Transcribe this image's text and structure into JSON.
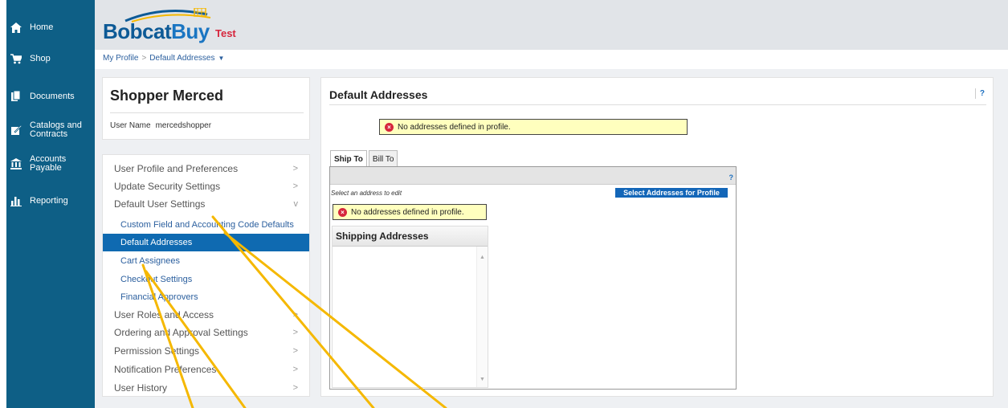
{
  "nav": {
    "items": [
      {
        "label": "Home",
        "icon": "home-icon"
      },
      {
        "label": "Shop",
        "icon": "cart-icon"
      },
      {
        "label": "Documents",
        "icon": "documents-icon"
      },
      {
        "label": "Catalogs and\nContracts",
        "icon": "catalog-icon"
      },
      {
        "label": "Accounts\nPayable",
        "icon": "bank-icon"
      },
      {
        "label": "Reporting",
        "icon": "bar-chart-icon"
      }
    ]
  },
  "logo": {
    "brand_a": "Bobcat",
    "brand_b": "Buy",
    "env": "Test"
  },
  "breadcrumb": {
    "root": "My Profile",
    "current": "Default Addresses",
    "separator": ">"
  },
  "profile": {
    "name": "Shopper Merced",
    "username_label": "User Name",
    "username": "mercedshopper"
  },
  "menu": {
    "items": [
      {
        "label": "User Profile and Preferences",
        "chevron": ">"
      },
      {
        "label": "Update Security Settings",
        "chevron": ">"
      },
      {
        "label": "Default User Settings",
        "chevron": "v"
      }
    ],
    "sub_items": [
      {
        "label": "Custom Field and Accounting Code Defaults"
      },
      {
        "label": "Default Addresses",
        "active": true
      },
      {
        "label": "Cart Assignees"
      },
      {
        "label": "Checkout Settings"
      },
      {
        "label": "Financial Approvers"
      }
    ],
    "more_items": [
      {
        "label": "User Roles and Access",
        "chevron": ">"
      },
      {
        "label": "Ordering and Approval Settings",
        "chevron": ">"
      },
      {
        "label": "Permission Settings",
        "chevron": ">"
      },
      {
        "label": "Notification Preferences",
        "chevron": ">"
      },
      {
        "label": "User History",
        "chevron": ">"
      }
    ]
  },
  "main": {
    "title": "Default Addresses",
    "help": "?",
    "alert_top": "No addresses defined in profile.",
    "tabs": [
      {
        "label": "Ship To",
        "active": true
      },
      {
        "label": "Bill To",
        "active": false
      }
    ],
    "frame_help": "?",
    "hint": "Select an address to edit",
    "select_button": "Select Addresses for Profile",
    "alert_inner": "No addresses defined in profile.",
    "shipping_header": "Shipping Addresses"
  },
  "colors": {
    "nav_bg": "#0e5f86",
    "active_bg": "#0f6ab1",
    "alert_bg": "#ffffbe",
    "annotation": "#f5b800"
  }
}
